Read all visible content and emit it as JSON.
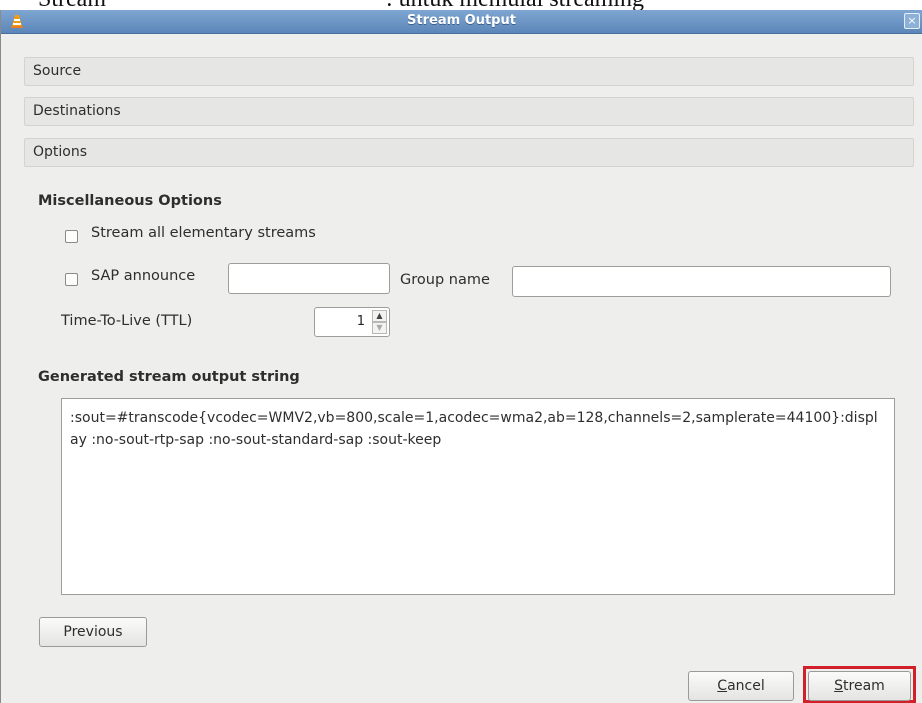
{
  "document": {
    "text_left": "Stream",
    "text_right": ": untuk memulai streaming"
  },
  "window": {
    "title": "Stream Output",
    "close_glyph": "×"
  },
  "sections": {
    "source": "Source",
    "destinations": "Destinations",
    "options": "Options"
  },
  "misc": {
    "heading": "Miscellaneous Options",
    "stream_all_label": "Stream all elementary streams",
    "sap_label": "SAP announce",
    "sap_value": "",
    "group_name_label": "Group name",
    "group_name_value": "",
    "ttl_label": "Time-To-Live (TTL)",
    "ttl_value": "1"
  },
  "output": {
    "heading": "Generated stream output string",
    "text": ":sout=#transcode{vcodec=WMV2,vb=800,scale=1,acodec=wma2,ab=128,channels=2,samplerate=44100}:display :no-sout-rtp-sap :no-sout-standard-sap :sout-keep"
  },
  "buttons": {
    "previous": "Previous",
    "cancel_first": "C",
    "cancel_rest": "ancel",
    "stream_first": "S",
    "stream_rest": "tream"
  },
  "colors": {
    "titlebar": "#5c86b8",
    "highlight": "#d1202a"
  },
  "icons": {
    "app": "vlc-cone-icon",
    "close": "close-icon",
    "spin_up": "chevron-up-icon",
    "spin_down": "chevron-down-icon"
  }
}
